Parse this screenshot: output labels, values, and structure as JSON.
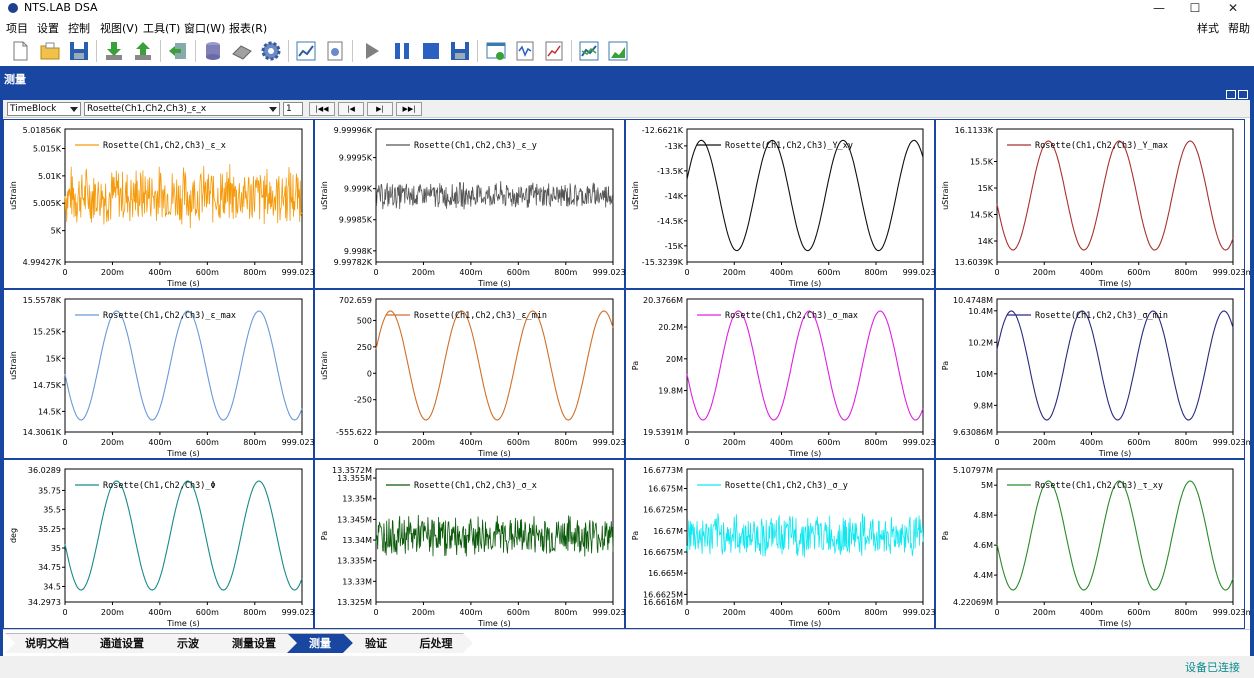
{
  "app": {
    "title": "NTS.LAB DSA"
  },
  "window": {
    "minimize": "—",
    "maximize": "☐",
    "close": "✕"
  },
  "menu": {
    "items": [
      "项目",
      "设置",
      "控制",
      "视图(V)",
      "工具(T)",
      "窗口(W)",
      "报表(R)"
    ],
    "right": [
      "样式",
      "帮助"
    ]
  },
  "toolbar": {
    "icons": [
      "new-file-icon",
      "open-folder-icon",
      "save-icon",
      "download-icon",
      "upload-icon",
      "export-icon",
      "database-icon",
      "eraser-icon",
      "gear-icon",
      "chart-line-icon",
      "settings-doc-icon",
      "play-icon",
      "pause-icon",
      "stop-icon",
      "save-data-icon",
      "add-window-icon",
      "waveform-icon",
      "trend-icon",
      "chart-compare-icon",
      "chart-area-icon"
    ]
  },
  "panel": {
    "title": "测量"
  },
  "controls": {
    "mode": "TimeBlock",
    "channel": "Rosette(Ch1,Ch2,Ch3)_ε_x",
    "page": "1",
    "nav": [
      "|◀◀",
      "|◀",
      "▶|",
      "▶▶|"
    ]
  },
  "chart_data": [
    {
      "type": "line",
      "title": "Rosette(Ch1,Ch2,Ch3)_ε_x",
      "ylabel": "uStrain",
      "xlabel": "Time (s)",
      "ylim": [
        4994.27,
        5018.56
      ],
      "yticks_top": "5.01856K",
      "yticks_bottom": "4.99427K",
      "yticks": [
        "5.015K",
        "5.01K",
        "5.005K",
        "5K"
      ],
      "ytick_values": [
        5015,
        5010,
        5005,
        5000
      ],
      "xticks": [
        "0",
        "200m",
        "400m",
        "600m",
        "800m",
        "999.023m"
      ],
      "color": "#f59a0a",
      "pattern": "noise",
      "amp": 5.5,
      "period": 0
    },
    {
      "type": "line",
      "title": "Rosette(Ch1,Ch2,Ch3)_ε_y",
      "ylabel": "uStrain",
      "xlabel": "Time (s)",
      "ylim": [
        9997.82,
        9999.96
      ],
      "yticks_top": "9.99996K",
      "yticks_bottom": "9.99782K",
      "yticks": [
        "9.9995K",
        "9.999K",
        "9.9985K",
        "9.998K"
      ],
      "ytick_values": [
        9999.5,
        9999.0,
        9998.5,
        9998.0
      ],
      "xticks": [
        "0",
        "200m",
        "400m",
        "600m",
        "800m",
        "999.023m"
      ],
      "color": "#555555",
      "pattern": "noise",
      "amp": 0.22,
      "period": 0
    },
    {
      "type": "line",
      "title": "Rosette(Ch1,Ch2,Ch3)_Y_xy",
      "ylabel": "uStrain",
      "xlabel": "Time (s)",
      "ylim": [
        -15323.9,
        -12662.1
      ],
      "yticks_top": "-12.6621K",
      "yticks_bottom": "-15.3239K",
      "yticks": [
        "-13K",
        "-13.5K",
        "-14K",
        "-14.5K",
        "-15K"
      ],
      "ytick_values": [
        -13000,
        -13500,
        -14000,
        -14500,
        -15000
      ],
      "xticks": [
        "0",
        "200m",
        "400m",
        "600m",
        "800m",
        "999.023m"
      ],
      "color": "#111111",
      "pattern": "sine",
      "amp": 0.83,
      "phase": 0.3,
      "period": 0.3
    },
    {
      "type": "line",
      "title": "Rosette(Ch1,Ch2,Ch3)_Y_max",
      "ylabel": "uStrain",
      "xlabel": "Time (s)",
      "ylim": [
        13603.9,
        16113.3
      ],
      "yticks_top": "16.1133K",
      "yticks_bottom": "13.6039K",
      "yticks": [
        "15.5K",
        "15K",
        "14.5K",
        "14K"
      ],
      "ytick_values": [
        15500,
        15000,
        14500,
        14000
      ],
      "xticks": [
        "0",
        "200m",
        "400m",
        "600m",
        "800m",
        "999.023m"
      ],
      "color": "#a83232",
      "pattern": "sine",
      "amp": 0.82,
      "phase": 3.3,
      "period": 0.3
    },
    {
      "type": "line",
      "title": "Rosette(Ch1,Ch2,Ch3)_ε_max",
      "ylabel": "uStrain",
      "xlabel": "Time (s)",
      "ylim": [
        14306.1,
        15557.8
      ],
      "yticks_top": "15.5578K",
      "yticks_bottom": "14.3061K",
      "yticks": [
        "15.25K",
        "15K",
        "14.75K",
        "14.5K"
      ],
      "ytick_values": [
        15250,
        15000,
        14750,
        14500
      ],
      "xticks": [
        "0",
        "200m",
        "400m",
        "600m",
        "800m",
        "999.023m"
      ],
      "color": "#6a9ad8",
      "pattern": "sine",
      "amp": 0.82,
      "phase": 3.3,
      "period": 0.3
    },
    {
      "type": "line",
      "title": "Rosette(Ch1,Ch2,Ch3)_ε_min",
      "ylabel": "uStrain",
      "xlabel": "Time (s)",
      "ylim": [
        -555.622,
        702.659
      ],
      "yticks_top": "702.659",
      "yticks_bottom": "-555.622",
      "yticks": [
        "500",
        "250",
        "0",
        "-250"
      ],
      "ytick_values": [
        500,
        250,
        0,
        -250
      ],
      "xticks": [
        "0",
        "200m",
        "400m",
        "600m",
        "800m",
        "999.023m"
      ],
      "color": "#d0702a",
      "pattern": "sine",
      "amp": 0.82,
      "phase": 0.3,
      "period": 0.3
    },
    {
      "type": "line",
      "title": "Rosette(Ch1,Ch2,Ch3)_σ_max",
      "ylabel": "Pa",
      "xlabel": "Time (s)",
      "ylim": [
        19539100,
        20376600
      ],
      "yticks_top": "20.3766M",
      "yticks_bottom": "19.5391M",
      "yticks": [
        "20.2M",
        "20M",
        "19.8M"
      ],
      "ytick_values": [
        20200000,
        20000000,
        19800000
      ],
      "xticks": [
        "0",
        "200m",
        "400m",
        "600m",
        "800m",
        "999.023m"
      ],
      "color": "#e020e0",
      "pattern": "sine",
      "amp": 0.82,
      "phase": 3.3,
      "period": 0.3
    },
    {
      "type": "line",
      "title": "Rosette(Ch1,Ch2,Ch3)_σ_min",
      "ylabel": "Pa",
      "xlabel": "Time (s)",
      "ylim": [
        9630860,
        10474800
      ],
      "yticks_top": "10.4748M",
      "yticks_bottom": "9.63086M",
      "yticks": [
        "10.4M",
        "10.2M",
        "10M",
        "9.8M"
      ],
      "ytick_values": [
        10400000,
        10200000,
        10000000,
        9800000
      ],
      "xticks": [
        "0",
        "200m",
        "400m",
        "600m",
        "800m",
        "999.023m"
      ],
      "color": "#2a2a80",
      "pattern": "sine",
      "amp": 0.82,
      "phase": 0.3,
      "period": 0.3
    },
    {
      "type": "line",
      "title": "Rosette(Ch1,Ch2,Ch3)_Φ",
      "ylabel": "deg",
      "xlabel": "Time (s)",
      "ylim": [
        34.2973,
        36.0289
      ],
      "yticks_top": "36.0289",
      "yticks_bottom": "34.2973",
      "yticks": [
        "35.75",
        "35.5",
        "35.25",
        "35",
        "34.75",
        "34.5"
      ],
      "ytick_values": [
        35.75,
        35.5,
        35.25,
        35,
        34.75,
        34.5
      ],
      "xticks": [
        "0",
        "200m",
        "400m",
        "600m",
        "800m",
        "999.023m"
      ],
      "color": "#1a8a8a",
      "pattern": "sine",
      "amp": 0.82,
      "phase": 3.3,
      "period": 0.3
    },
    {
      "type": "line",
      "title": "Rosette(Ch1,Ch2,Ch3)_σ_x",
      "ylabel": "Pa",
      "xlabel": "Time (s)",
      "ylim": [
        13325000,
        13357200
      ],
      "yticks_top": "13.3572M",
      "yticks_bottom": "13.325M",
      "yticks": [
        "13.355M",
        "13.35M",
        "13.345M",
        "13.34M",
        "13.335M",
        "13.33M"
      ],
      "ytick_values": [
        13355000,
        13350000,
        13345000,
        13340000,
        13335000,
        13330000
      ],
      "xticks": [
        "0",
        "200m",
        "400m",
        "600m",
        "800m",
        "999.023m"
      ],
      "color": "#0a5a0a",
      "pattern": "noise",
      "amp": 5000,
      "period": 0
    },
    {
      "type": "line",
      "title": "Rosette(Ch1,Ch2,Ch3)_σ_y",
      "ylabel": "Pa",
      "xlabel": "Time (s)",
      "ylim": [
        16661600,
        16677300
      ],
      "yticks_top": "16.6773M",
      "yticks_bottom": "16.6616M",
      "yticks": [
        "16.675M",
        "16.6725M",
        "16.67M",
        "16.6675M",
        "16.665M",
        "16.6625M"
      ],
      "ytick_values": [
        16675000,
        16672500,
        16670000,
        16667500,
        16665000,
        16662500
      ],
      "xticks": [
        "0",
        "200m",
        "400m",
        "600m",
        "800m",
        "999.023m"
      ],
      "color": "#10e8f0",
      "pattern": "noise",
      "amp": 2500,
      "period": 0
    },
    {
      "type": "line",
      "title": "Rosette(Ch1,Ch2,Ch3)_τ_xy",
      "ylabel": "Pa",
      "xlabel": "Time (s)",
      "ylim": [
        4220690,
        5107970
      ],
      "yticks_top": "5.10797M",
      "yticks_bottom": "4.22069M",
      "yticks": [
        "5M",
        "4.8M",
        "4.6M",
        "4.4M"
      ],
      "ytick_values": [
        5000000,
        4800000,
        4600000,
        4400000
      ],
      "xticks": [
        "0",
        "200m",
        "400m",
        "600m",
        "800m",
        "999.023m"
      ],
      "color": "#2a8a2a",
      "pattern": "sine",
      "amp": 0.82,
      "phase": 3.3,
      "period": 0.3
    }
  ],
  "tabs": [
    "说明文档",
    "通道设置",
    "示波",
    "测量设置",
    "测量",
    "验证",
    "后处理"
  ],
  "active_tab": "测量",
  "status": "设备已连接"
}
